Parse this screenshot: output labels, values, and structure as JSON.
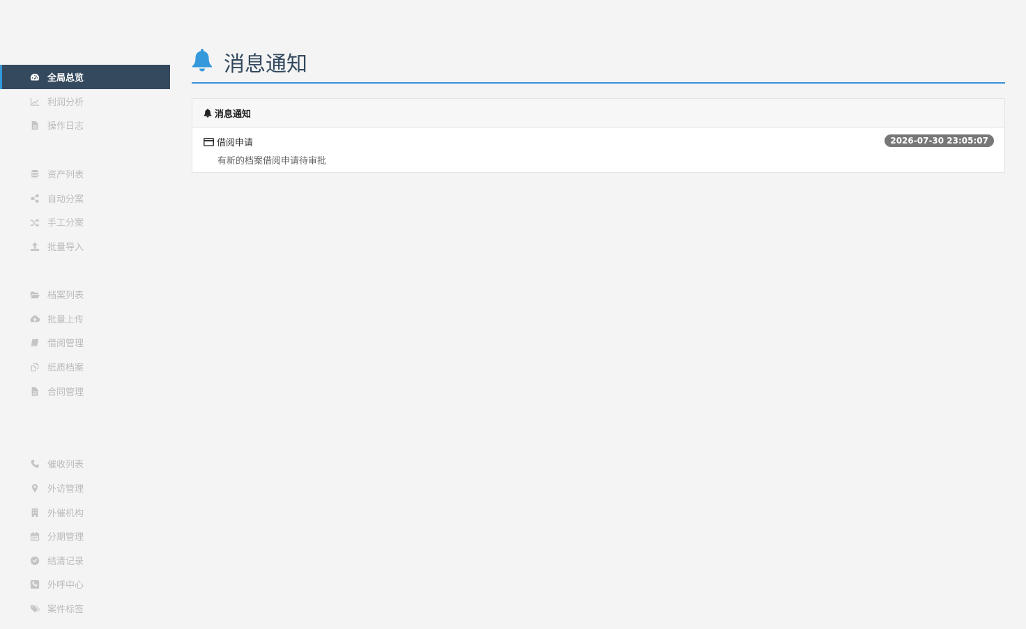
{
  "sidebar": {
    "items": [
      {
        "label": "全局总览",
        "icon": "dashboard-icon"
      },
      {
        "label": "利润分析",
        "icon": "line-chart-icon"
      },
      {
        "label": "操作日志",
        "icon": "file-icon"
      },
      {
        "label": "资产列表",
        "icon": "database-icon"
      },
      {
        "label": "自动分案",
        "icon": "share-icon"
      },
      {
        "label": "手工分案",
        "icon": "shuffle-icon"
      },
      {
        "label": "批量导入",
        "icon": "upload-icon"
      },
      {
        "label": "档案列表",
        "icon": "folder-open-icon"
      },
      {
        "label": "批量上传",
        "icon": "cloud-upload-icon"
      },
      {
        "label": "借阅管理",
        "icon": "book-icon"
      },
      {
        "label": "纸质档案",
        "icon": "copy-icon"
      },
      {
        "label": "合同管理",
        "icon": "file-icon"
      },
      {
        "label": "催收列表",
        "icon": "phone-icon"
      },
      {
        "label": "外访管理",
        "icon": "map-marker-icon"
      },
      {
        "label": "外催机构",
        "icon": "building-icon"
      },
      {
        "label": "分期管理",
        "icon": "calendar-icon"
      },
      {
        "label": "结清记录",
        "icon": "check-circle-icon"
      },
      {
        "label": "外呼中心",
        "icon": "phone-square-icon"
      },
      {
        "label": "案件标签",
        "icon": "tags-icon"
      }
    ],
    "active_index": 0
  },
  "header": {
    "title": "消息通知",
    "icon": "bell-icon"
  },
  "panel": {
    "heading": "消息通知",
    "messages": [
      {
        "title": "借阅申请",
        "description": "有新的档案借阅申请待审批",
        "timestamp": "2026-07-30 23:05:07",
        "icon": "credit-card-icon"
      }
    ]
  },
  "colors": {
    "accent": "#3498db",
    "sidebar_active_bg": "#34495e",
    "badge_bg": "#777777"
  }
}
